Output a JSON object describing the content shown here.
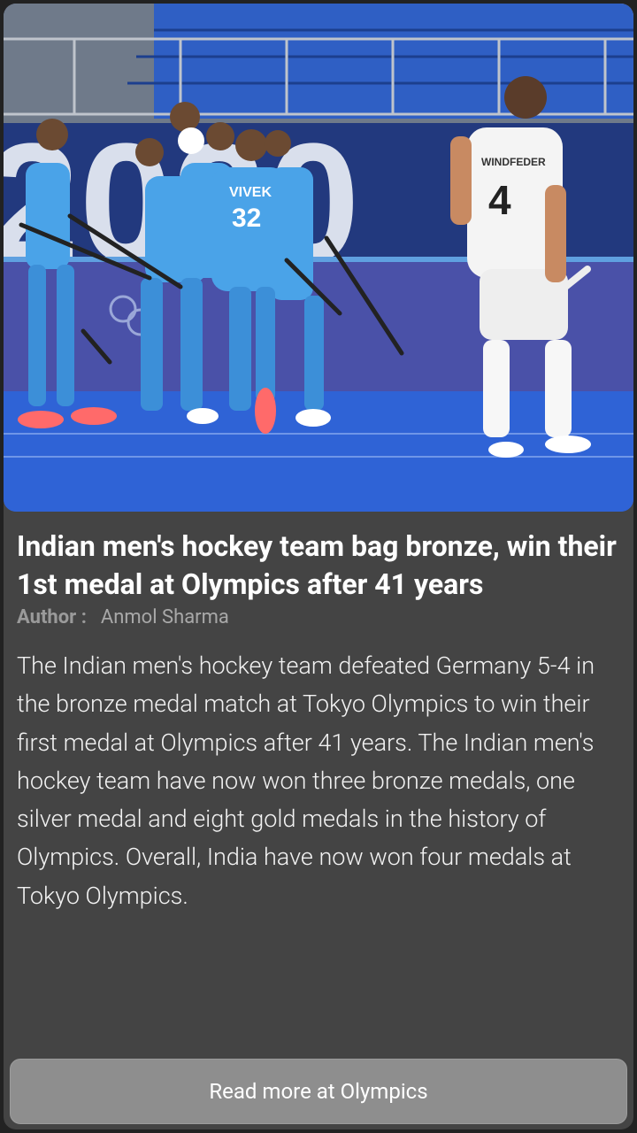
{
  "article": {
    "headline": "Indian men's hockey team bag bronze, win their 1st medal at Olympics after 41 years",
    "author_label": "Author :",
    "author_name": "Anmol Sharma",
    "body": "The Indian men's hockey team defeated Germany 5-4 in the bronze medal match at Tokyo Olympics to win their first medal at Olympics after 41 years. The Indian men's hockey team have now won three bronze medals, one silver medal and eight gold medals in the history of Olympics. Overall, India have now won four medals at Tokyo Olympics."
  },
  "hero_image": {
    "jersey_name_india": "VIVEK",
    "jersey_number_india": "32",
    "jersey_name_germany": "WINDFEDER",
    "jersey_number_germany": "4",
    "banner_text": "2020",
    "colors": {
      "field": "#2f63d6",
      "india_kit": "#4aa3e8",
      "germany_kit": "#f4f4f4",
      "stands": "#2a4fa8"
    }
  },
  "footer": {
    "read_more_label": "Read more at Olympics"
  }
}
